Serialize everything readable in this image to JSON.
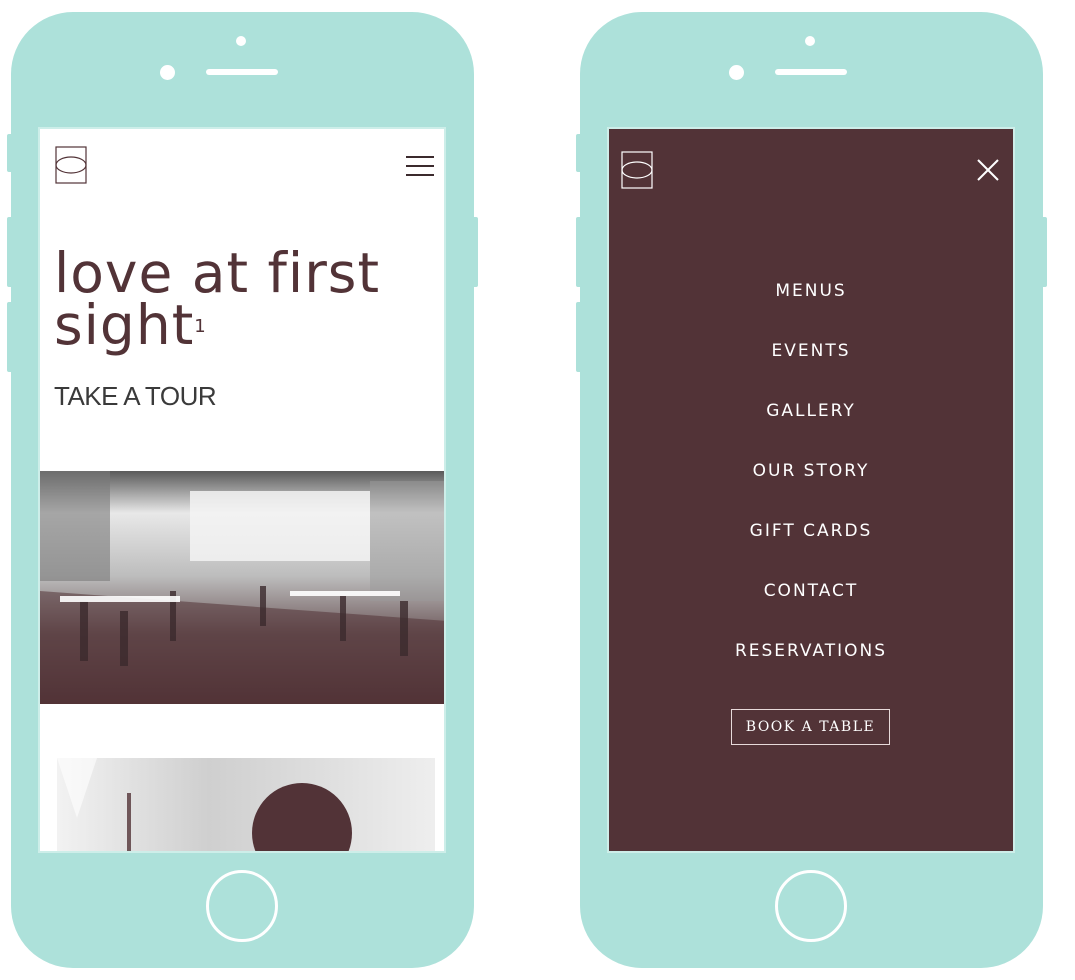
{
  "colors": {
    "phone_body": "#ade1da",
    "brand_dark": "#523337",
    "screen_white": "#ffffff",
    "menu_text": "#ffffff"
  },
  "left_screen": {
    "logo_icon": "brand-logo-icon",
    "menu_icon": "hamburger-menu-icon",
    "hero": {
      "title": "love at first sight",
      "superscript": "1"
    },
    "tour_link": "TAKE A TOUR"
  },
  "right_screen": {
    "logo_icon": "brand-logo-icon",
    "close_icon": "close-icon",
    "menu_items": [
      "MENUS",
      "EVENTS",
      "GALLERY",
      "OUR STORY",
      "GIFT CARDS",
      "CONTACT",
      "RESERVATIONS"
    ],
    "book_button": "BOOK A TABLE"
  }
}
